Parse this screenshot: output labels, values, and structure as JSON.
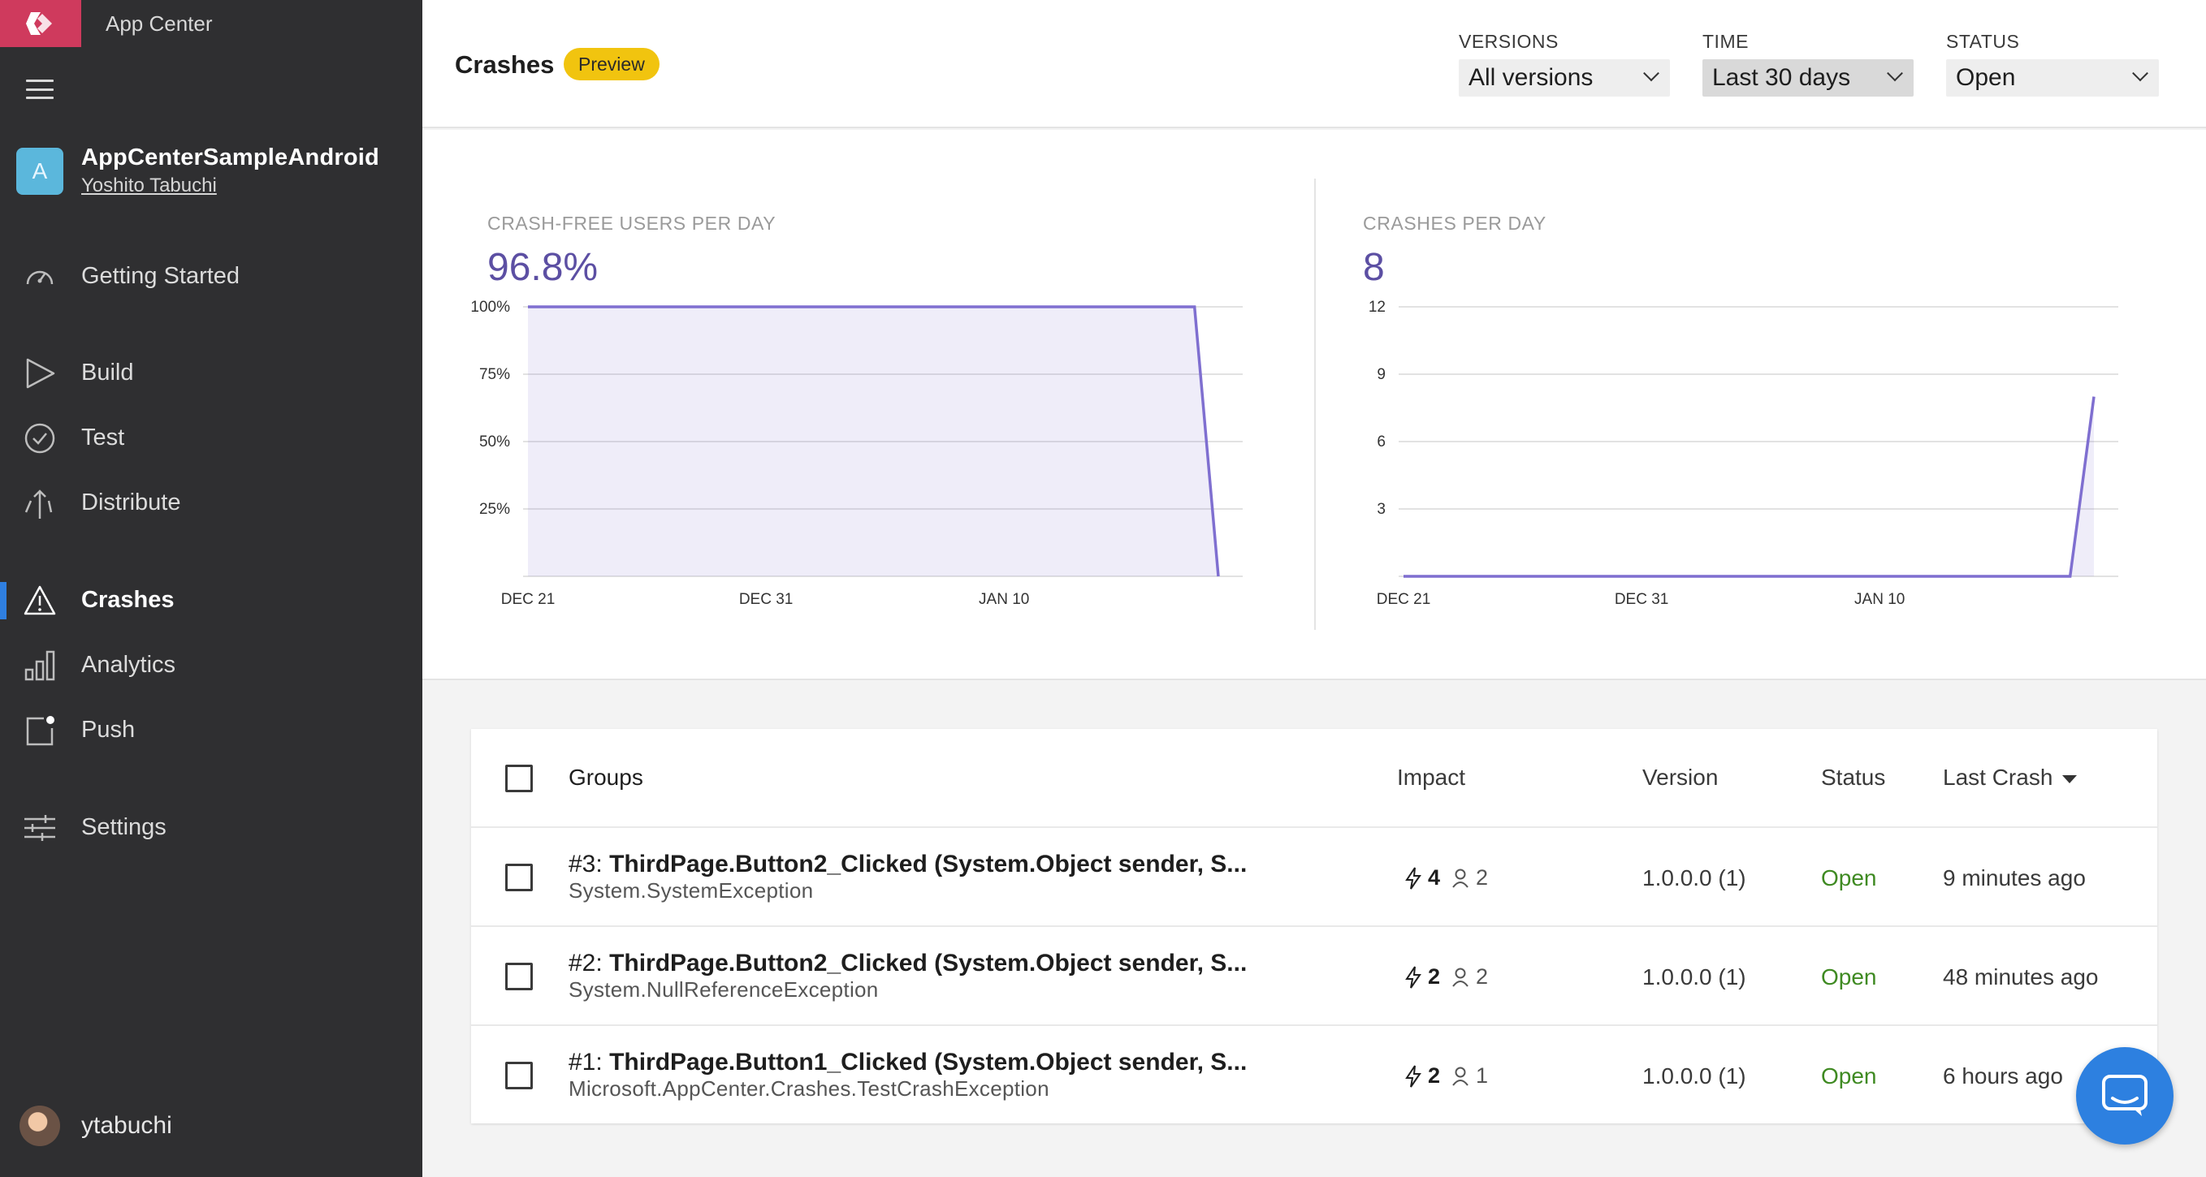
{
  "brand": {
    "name": "App Center",
    "logo_color": "#cf3a5d"
  },
  "app": {
    "avatar_letter": "A",
    "name": "AppCenterSampleAndroid",
    "owner": "Yoshito Tabuchi"
  },
  "nav": {
    "getting_started": "Getting Started",
    "build": "Build",
    "test": "Test",
    "distribute": "Distribute",
    "crashes": "Crashes",
    "analytics": "Analytics",
    "push": "Push",
    "settings": "Settings"
  },
  "user": {
    "name": "ytabuchi"
  },
  "header": {
    "title": "Crashes",
    "badge": "Preview",
    "filters": {
      "versions": {
        "label": "VERSIONS",
        "value": "All versions"
      },
      "time": {
        "label": "TIME",
        "value": "Last 30 days"
      },
      "status": {
        "label": "STATUS",
        "value": "Open"
      }
    }
  },
  "chart_data": [
    {
      "type": "area",
      "title": "CRASH-FREE USERS PER DAY",
      "headline": "96.8%",
      "x_ticks": [
        "DEC 21",
        "DEC 31",
        "JAN 10"
      ],
      "y_ticks": [
        "100%",
        "75%",
        "50%",
        "25%"
      ],
      "ylim": [
        0,
        100
      ],
      "x": [
        "Dec 21",
        "Jan 18",
        "Jan 19"
      ],
      "values": [
        100,
        100,
        0
      ],
      "color": "#7f6fd0"
    },
    {
      "type": "area",
      "title": "CRASHES PER DAY",
      "headline": "8",
      "x_ticks": [
        "DEC 21",
        "DEC 31",
        "JAN 10"
      ],
      "y_ticks": [
        "12",
        "9",
        "6",
        "3"
      ],
      "ylim": [
        0,
        12
      ],
      "x": [
        "Dec 21",
        "Jan 18",
        "Jan 19"
      ],
      "values": [
        0,
        0,
        8
      ],
      "color": "#7f6fd0"
    }
  ],
  "table": {
    "headers": {
      "groups": "Groups",
      "impact": "Impact",
      "version": "Version",
      "status": "Status",
      "last_crash": "Last Crash"
    },
    "rows": [
      {
        "id": "#3:",
        "method": "ThirdPage.Button2_Clicked (System.Object sender, S...",
        "exception": "System.SystemException",
        "crashes": "4",
        "users": "2",
        "version": "1.0.0.0 (1)",
        "status": "Open",
        "last_crash": "9 minutes ago"
      },
      {
        "id": "#2:",
        "method": "ThirdPage.Button2_Clicked (System.Object sender, S...",
        "exception": "System.NullReferenceException",
        "crashes": "2",
        "users": "2",
        "version": "1.0.0.0 (1)",
        "status": "Open",
        "last_crash": "48 minutes ago"
      },
      {
        "id": "#1:",
        "method": "ThirdPage.Button1_Clicked (System.Object sender, S...",
        "exception": "Microsoft.AppCenter.Crashes.TestCrashException",
        "crashes": "2",
        "users": "1",
        "version": "1.0.0.0 (1)",
        "status": "Open",
        "last_crash": "6 hours ago"
      }
    ]
  }
}
